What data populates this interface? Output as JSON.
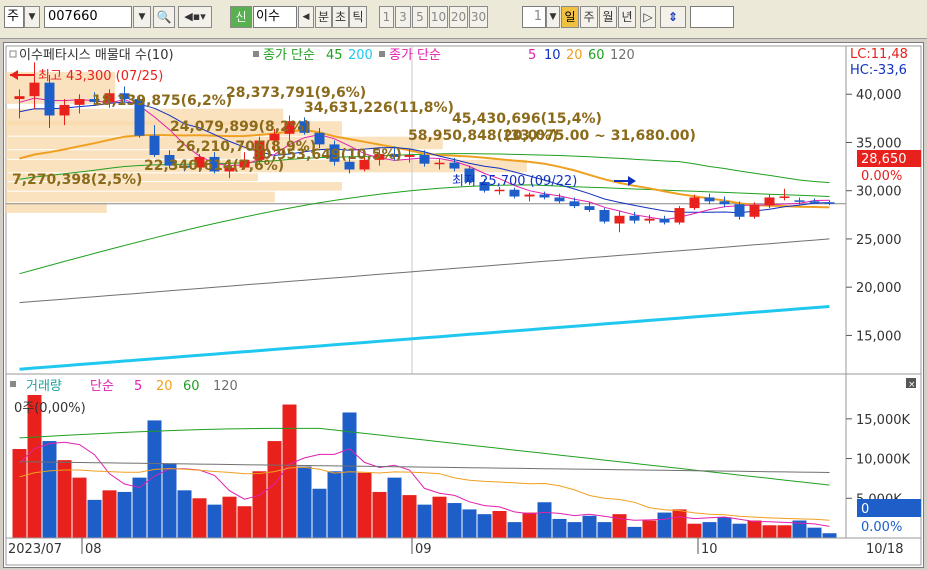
{
  "toolbar": {
    "market": "주",
    "code": "007660",
    "badge": "신",
    "name": "이수",
    "nav_prev": "◀",
    "periods": [
      "분",
      "초",
      "틱"
    ],
    "nums": [
      "1",
      "3",
      "5",
      "10",
      "20",
      "30"
    ],
    "count": "1",
    "day": "일",
    "week": "주",
    "month": "월",
    "year": "년",
    "nav_next": "▷",
    "updown": "⇕"
  },
  "price_panel": {
    "legend_stock": "이수페타시스 매물대 수(10)",
    "legend_ma_label": "종가 단순",
    "legend_ma45": "45",
    "legend_ma200": "200",
    "legend_ma_label2": "종가 단순",
    "legend_ma5": "5",
    "legend_ma10": "10",
    "legend_ma20": "20",
    "legend_ma60": "60",
    "legend_ma120": "120",
    "lc": "LC:11,48",
    "hc": "HC:-33,6",
    "high_label": "최고 43,300 (07/25)",
    "low_label": "최저 25,700 (09/22)",
    "current_price": "28,650",
    "current_change": "0.00%",
    "range_label": "(33,075.00 ~ 31,680.00)",
    "volume_profile": [
      "18,139,875(6,2%)",
      "28,373,791(9,6%)",
      "34,631,226(11,8%)",
      "45,430,696(15,4%)",
      "24,079,899(8,2%)",
      "58,950,848(20,0%)",
      "26,210,706(8,9%)",
      "30,953,649(10,5%)",
      "22,340,614(7,6%)",
      "7,270,398(2,5%)"
    ],
    "y_ticks": [
      "40,000",
      "35,000",
      "30,000",
      "25,000",
      "20,000",
      "15,000"
    ]
  },
  "volume_panel": {
    "legend_vol": "거래량",
    "legend_ma": "단순",
    "legend_ma5": "5",
    "legend_ma20": "20",
    "legend_ma60": "60",
    "legend_ma120": "120",
    "vol_label": "0주(0,00%)",
    "y_ticks": [
      "15,000K",
      "10,000K",
      "5,000K"
    ],
    "current_vol": "0",
    "current_pct": "0.00%"
  },
  "x_axis": {
    "labels": [
      "2023/07",
      "08",
      "09",
      "10"
    ],
    "right_date": "10/18"
  },
  "colors": {
    "up": "#e8211c",
    "down": "#1e5ec8",
    "ma5": "#e020b0",
    "ma10": "#1030c0",
    "ma20": "#f0a020",
    "ma60": "#20a020",
    "ma120": "#707070",
    "ma200": "#20c8f0",
    "profile": "#f8d8a8",
    "profile_text": "#8b6a1a"
  },
  "chart_data": {
    "type": "candlestick",
    "price_ylim": [
      11000,
      45000
    ],
    "volume_ylim": [
      0,
      18000000
    ],
    "candles": [
      {
        "o": 39500,
        "h": 40500,
        "l": 37500,
        "c": 39800
      },
      {
        "o": 39800,
        "h": 43300,
        "l": 38500,
        "c": 41200
      },
      {
        "o": 41200,
        "h": 42000,
        "l": 36500,
        "c": 37800
      },
      {
        "o": 37800,
        "h": 39500,
        "l": 36800,
        "c": 38900
      },
      {
        "o": 38900,
        "h": 40000,
        "l": 38000,
        "c": 39500
      },
      {
        "o": 39500,
        "h": 40200,
        "l": 38800,
        "c": 39200
      },
      {
        "o": 39200,
        "h": 40500,
        "l": 38600,
        "c": 40100
      },
      {
        "o": 40100,
        "h": 40800,
        "l": 39200,
        "c": 39500
      },
      {
        "o": 39500,
        "h": 39800,
        "l": 35500,
        "c": 35700
      },
      {
        "o": 35700,
        "h": 36800,
        "l": 33500,
        "c": 33700
      },
      {
        "o": 33700,
        "h": 34200,
        "l": 32300,
        "c": 32600
      },
      {
        "o": 32600,
        "h": 33000,
        "l": 32000,
        "c": 32400
      },
      {
        "o": 32400,
        "h": 33800,
        "l": 32100,
        "c": 33500
      },
      {
        "o": 33500,
        "h": 34000,
        "l": 31800,
        "c": 32000
      },
      {
        "o": 32000,
        "h": 32800,
        "l": 31300,
        "c": 32400
      },
      {
        "o": 32400,
        "h": 34000,
        "l": 32200,
        "c": 33200
      },
      {
        "o": 33200,
        "h": 35600,
        "l": 32800,
        "c": 35200
      },
      {
        "o": 35200,
        "h": 36400,
        "l": 34000,
        "c": 35900
      },
      {
        "o": 35900,
        "h": 37800,
        "l": 35200,
        "c": 37200
      },
      {
        "o": 37200,
        "h": 37600,
        "l": 35800,
        "c": 36000
      },
      {
        "o": 36000,
        "h": 36500,
        "l": 34400,
        "c": 34800
      },
      {
        "o": 34800,
        "h": 35200,
        "l": 32600,
        "c": 33000
      },
      {
        "o": 33000,
        "h": 33600,
        "l": 31800,
        "c": 32200
      },
      {
        "o": 32200,
        "h": 33800,
        "l": 32000,
        "c": 33200
      },
      {
        "o": 33200,
        "h": 34200,
        "l": 32600,
        "c": 33800
      },
      {
        "o": 33800,
        "h": 34600,
        "l": 33100,
        "c": 33500
      },
      {
        "o": 33500,
        "h": 34400,
        "l": 32900,
        "c": 33700
      },
      {
        "o": 33700,
        "h": 34200,
        "l": 32500,
        "c": 32800
      },
      {
        "o": 32800,
        "h": 33300,
        "l": 32200,
        "c": 32900
      },
      {
        "o": 32900,
        "h": 33400,
        "l": 32000,
        "c": 32300
      },
      {
        "o": 32300,
        "h": 32600,
        "l": 30600,
        "c": 30900
      },
      {
        "o": 30900,
        "h": 31200,
        "l": 29800,
        "c": 30000
      },
      {
        "o": 30000,
        "h": 30400,
        "l": 29600,
        "c": 30100
      },
      {
        "o": 30100,
        "h": 30300,
        "l": 29200,
        "c": 29400
      },
      {
        "o": 29400,
        "h": 29800,
        "l": 28900,
        "c": 29600
      },
      {
        "o": 29600,
        "h": 29900,
        "l": 29100,
        "c": 29300
      },
      {
        "o": 29300,
        "h": 29700,
        "l": 28700,
        "c": 28900
      },
      {
        "o": 28900,
        "h": 29300,
        "l": 28200,
        "c": 28400
      },
      {
        "o": 28400,
        "h": 28800,
        "l": 27800,
        "c": 28000
      },
      {
        "o": 28000,
        "h": 28200,
        "l": 26600,
        "c": 26800
      },
      {
        "o": 26600,
        "h": 27900,
        "l": 25700,
        "c": 27400
      },
      {
        "o": 27400,
        "h": 27800,
        "l": 26600,
        "c": 26900
      },
      {
        "o": 26900,
        "h": 27500,
        "l": 26600,
        "c": 27100
      },
      {
        "o": 27100,
        "h": 27400,
        "l": 26500,
        "c": 26700
      },
      {
        "o": 26700,
        "h": 28400,
        "l": 26500,
        "c": 28200
      },
      {
        "o": 28200,
        "h": 29600,
        "l": 28000,
        "c": 29300
      },
      {
        "o": 29300,
        "h": 29700,
        "l": 28600,
        "c": 28900
      },
      {
        "o": 28900,
        "h": 29400,
        "l": 28300,
        "c": 28600
      },
      {
        "o": 28600,
        "h": 28900,
        "l": 27000,
        "c": 27300
      },
      {
        "o": 27300,
        "h": 28800,
        "l": 27100,
        "c": 28500
      },
      {
        "o": 28500,
        "h": 29600,
        "l": 28200,
        "c": 29300
      },
      {
        "o": 29300,
        "h": 30200,
        "l": 29000,
        "c": 29400
      },
      {
        "o": 29000,
        "h": 29300,
        "l": 28600,
        "c": 28900
      },
      {
        "o": 28900,
        "h": 29200,
        "l": 28700,
        "c": 28800
      },
      {
        "o": 28800,
        "h": 29000,
        "l": 28500,
        "c": 28650
      }
    ],
    "volume_k": [
      11200,
      18000,
      12200,
      9800,
      7600,
      4800,
      6000,
      5800,
      7600,
      14800,
      9400,
      6000,
      5000,
      4200,
      5200,
      4000,
      8400,
      12200,
      16800,
      9000,
      6200,
      8400,
      15800,
      8200,
      5800,
      7600,
      5400,
      4200,
      5200,
      4400,
      3600,
      3000,
      3400,
      2000,
      3200,
      4500,
      2400,
      2000,
      2800,
      2000,
      3000,
      1400,
      2200,
      3200,
      3600,
      1800,
      2000,
      2600,
      1800,
      2200,
      1600,
      1600,
      2200,
      1300,
      600
    ]
  }
}
